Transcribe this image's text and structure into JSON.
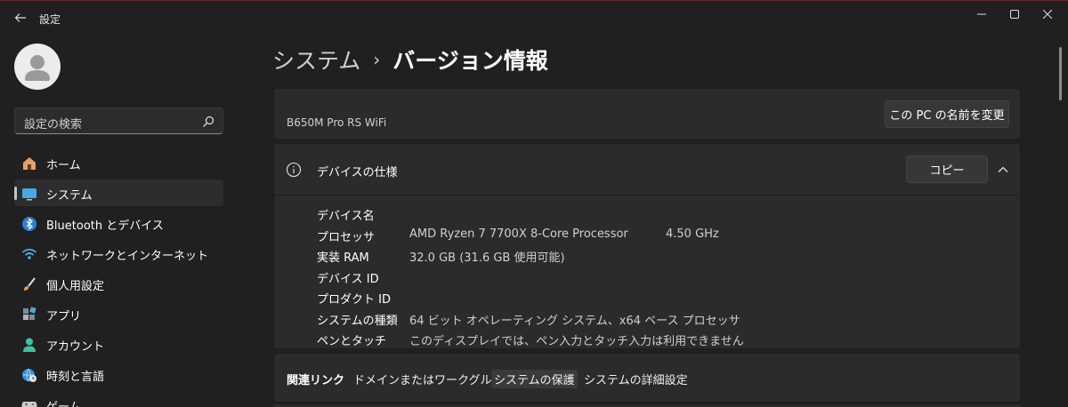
{
  "window": {
    "title": "設定",
    "controls": [
      "minimize-icon",
      "maximize-icon",
      "close-icon"
    ]
  },
  "sidebar": {
    "search_placeholder": "設定の検索",
    "items": [
      {
        "label": "ホーム",
        "icon": "home-icon"
      },
      {
        "label": "システム",
        "icon": "system-monitor-icon",
        "active": true
      },
      {
        "label": "Bluetooth とデバイス",
        "icon": "bluetooth-icon"
      },
      {
        "label": "ネットワークとインターネット",
        "icon": "wifi-icon"
      },
      {
        "label": "個人用設定",
        "icon": "brush-icon"
      },
      {
        "label": "アプリ",
        "icon": "apps-icon"
      },
      {
        "label": "アカウント",
        "icon": "account-icon"
      },
      {
        "label": "時刻と言語",
        "icon": "globe-clock-icon"
      },
      {
        "label": "ゲーム",
        "icon": "gamepad-icon"
      }
    ]
  },
  "breadcrumb": {
    "parent": "システム",
    "separator": "›",
    "current": "バージョン情報"
  },
  "device": {
    "model": "B650M Pro RS WiFi",
    "rename_button": "この PC の名前を変更"
  },
  "spec": {
    "title": "デバイスの仕様",
    "copy_button": "コピー",
    "rows": [
      {
        "label": "デバイス名",
        "value": "",
        "extra": ""
      },
      {
        "label": "プロセッサ",
        "value": "AMD Ryzen 7 7700X 8-Core Processor",
        "extra": "4.50 GHz"
      },
      {
        "label": "実装 RAM",
        "value": "32.0 GB (31.6 GB 使用可能)",
        "extra": ""
      },
      {
        "label": "デバイス ID",
        "value": "",
        "extra": ""
      },
      {
        "label": "プロダクト ID",
        "value": "",
        "extra": ""
      },
      {
        "label": "システムの種類",
        "value": "64 ビット オペレーティング システム、x64 ベース プロセッサ",
        "extra": ""
      },
      {
        "label": "ペンとタッチ",
        "value": "このディスプレイでは、ペン入力とタッチ入力は利用できません",
        "extra": ""
      }
    ]
  },
  "related_links": {
    "title": "関連リンク",
    "links": [
      "ドメインまたはワークグループ",
      "システムの保護",
      "システムの詳細設定"
    ]
  },
  "colors": {
    "background": "#202020",
    "card": "#2b2b2b",
    "active_indicator": "#b9c6d6"
  }
}
